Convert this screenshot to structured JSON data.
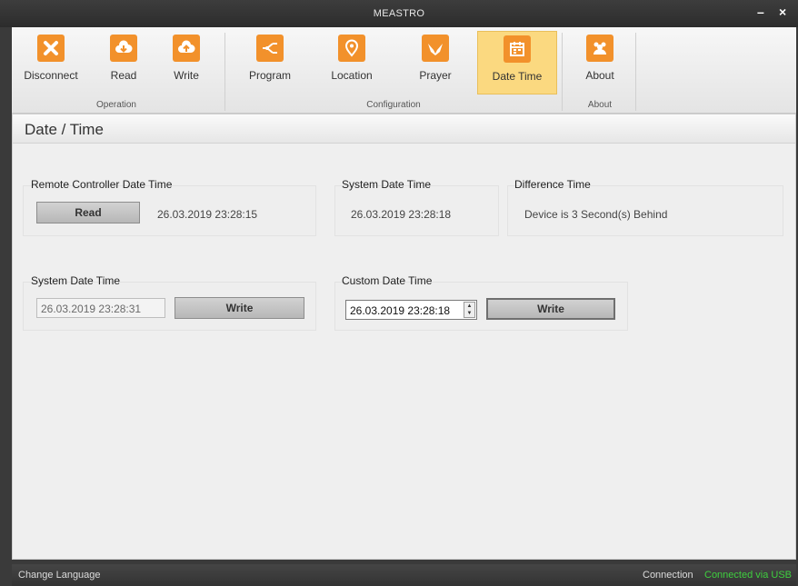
{
  "window": {
    "title": "MEASTRO",
    "minimize_glyph": "–",
    "close_glyph": "×"
  },
  "ribbon": {
    "buttons": [
      {
        "label": "Disconnect",
        "icon": "close-icon"
      },
      {
        "label": "Read",
        "icon": "cloud-download-icon"
      },
      {
        "label": "Write",
        "icon": "cloud-upload-icon"
      },
      {
        "label": "Program",
        "icon": "flow-icon"
      },
      {
        "label": "Location",
        "icon": "map-pin-icon"
      },
      {
        "label": "Prayer",
        "icon": "hands-icon"
      },
      {
        "label": "Date Time",
        "icon": "calendar-icon",
        "active": true
      },
      {
        "label": "About",
        "icon": "users-icon"
      }
    ],
    "groups": [
      "Operation",
      "Configuration",
      "About"
    ],
    "accent": "#f2912b",
    "active_bg": "#fbd980"
  },
  "page": {
    "title": "Date / Time"
  },
  "remote": {
    "title": "Remote Controller Date Time",
    "read_label": "Read",
    "value": "26.03.2019 23:28:15"
  },
  "system_top": {
    "title": "System Date Time",
    "value": "26.03.2019 23:28:18"
  },
  "difference": {
    "title": "Difference Time",
    "value": "Device is 3 Second(s) Behind"
  },
  "system_write": {
    "title": "System Date Time",
    "value": "26.03.2019 23:28:31",
    "write_label": "Write"
  },
  "custom_write": {
    "title": "Custom Date Time",
    "value": "26.03.2019 23:28:18",
    "write_label": "Write"
  },
  "status": {
    "change_language": "Change Language",
    "connection_label": "Connection",
    "connection_value": "Connected via USB",
    "connection_color": "#3fcf3f"
  }
}
